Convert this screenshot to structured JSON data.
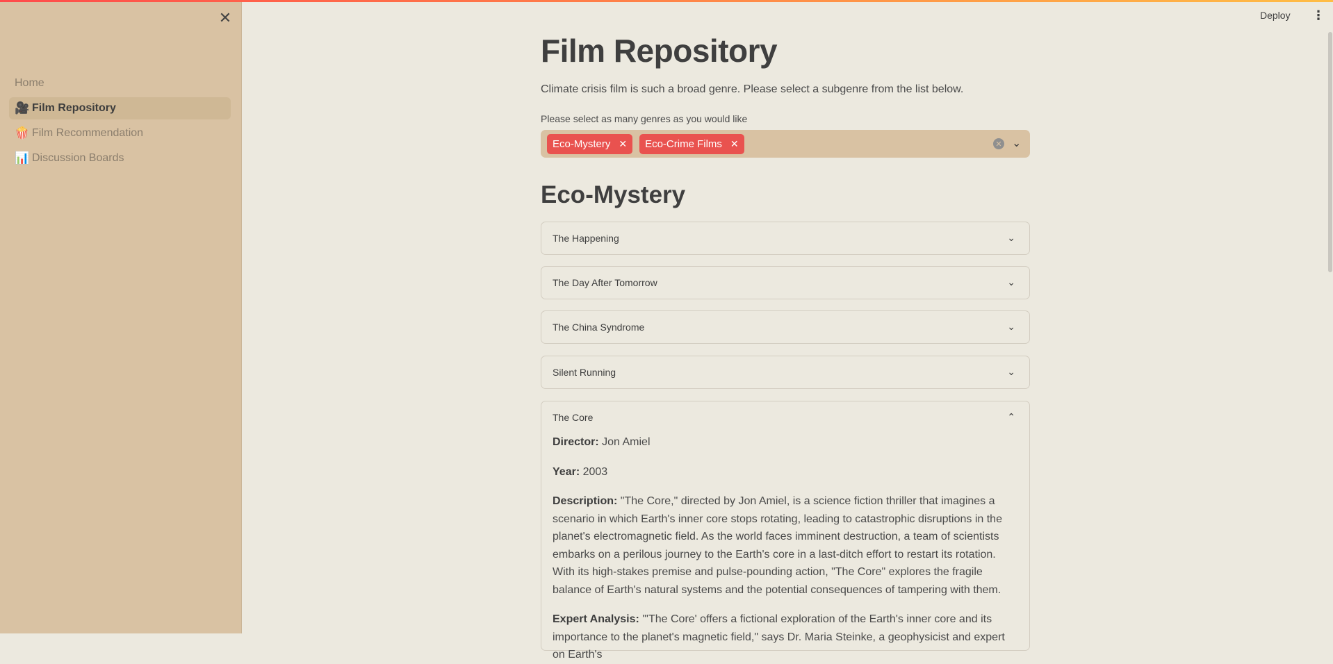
{
  "sidebar": {
    "close_icon": "close-icon",
    "items": [
      {
        "label": "Home",
        "icon": ""
      },
      {
        "label": "Film Repository",
        "icon": "🎥"
      },
      {
        "label": "Film Recommendation",
        "icon": "🍿"
      },
      {
        "label": "Discussion Boards",
        "icon": "📊"
      }
    ]
  },
  "header": {
    "deploy_label": "Deploy",
    "menu_icon": "⋮"
  },
  "main": {
    "title": "Film Repository",
    "intro": "Climate crisis film is such a broad genre. Please select a subgenre from the list below.",
    "select_label": "Please select as many genres as you would like",
    "selected_genres": [
      "Eco-Mystery",
      "Eco-Crime Films"
    ],
    "section_title": "Eco-Mystery",
    "films": [
      {
        "title": "The Happening"
      },
      {
        "title": "The Day After Tomorrow"
      },
      {
        "title": "The China Syndrome"
      },
      {
        "title": "Silent Running"
      },
      {
        "title": "The Core"
      }
    ],
    "expanded_film": {
      "director_label": "Director:",
      "director": "Jon Amiel",
      "year_label": "Year:",
      "year": "2003",
      "description_label": "Description:",
      "description": "\"The Core,\" directed by Jon Amiel, is a science fiction thriller that imagines a scenario in which Earth's inner core stops rotating, leading to catastrophic disruptions in the planet's electromagnetic field. As the world faces imminent destruction, a team of scientists embarks on a perilous journey to the Earth's core in a last-ditch effort to restart its rotation. With its high-stakes premise and pulse-pounding action, \"The Core\" explores the fragile balance of Earth's natural systems and the potential consequences of tampering with them.",
      "analysis_label": "Expert Analysis:",
      "analysis": "\"'The Core' offers a fictional exploration of the Earth's inner core and its importance to the planet's magnetic field,\" says Dr. Maria Steinke, a geophysicist and expert on Earth's"
    }
  },
  "colors": {
    "background": "#ece9df",
    "sidebar": "#d9c2a3",
    "chip": "#e9524f",
    "accent_gradient": [
      "#ff4b4b",
      "#ffbd45"
    ]
  }
}
